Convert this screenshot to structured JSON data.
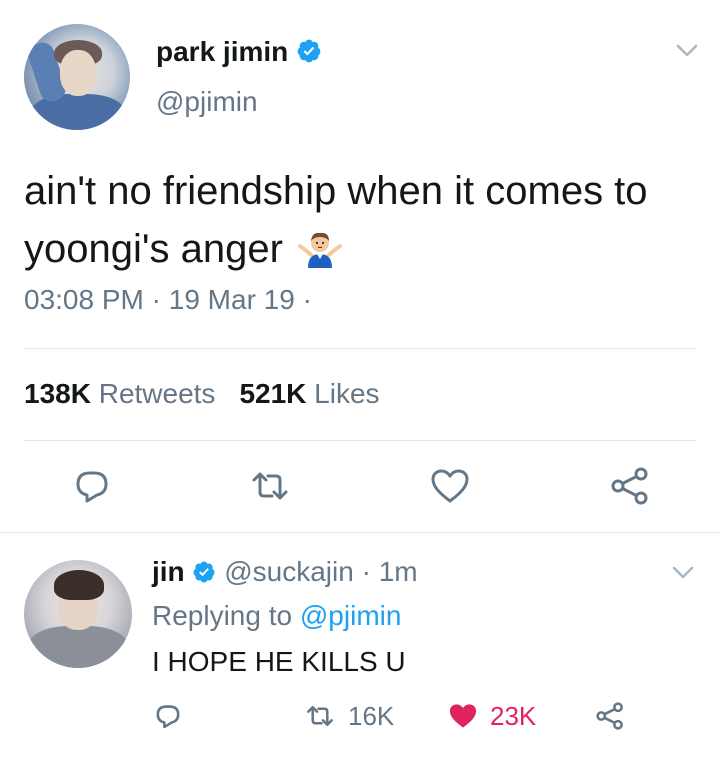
{
  "tweet": {
    "display_name": "park jimin",
    "handle": "@pjimin",
    "text": "ain't no friendship when it comes to yoongi's anger",
    "emoji": "shrug-person-emoji",
    "time": "03:08 PM",
    "sep1": " · ",
    "date": "19 Mar 19",
    "sep2": " · ",
    "retweets_count": "138K",
    "retweets_label": "Retweets",
    "likes_count": "521K",
    "likes_label": "Likes",
    "actions": [
      "reply-icon",
      "retweet-icon",
      "heart-icon",
      "share-icon"
    ]
  },
  "reply": {
    "display_name": "jin",
    "handle": "@suckajin",
    "age": "· 1m",
    "replying_label": "Replying to",
    "replying_to": "@pjimin",
    "text": "I HOPE HE KILLS U",
    "retweets": "16K",
    "likes": "23K",
    "liked": true
  },
  "colors": {
    "accent": "#1da1f2",
    "text": "#14171a",
    "muted": "#657786",
    "like": "#e0245e",
    "divider": "#e1e8ed"
  }
}
